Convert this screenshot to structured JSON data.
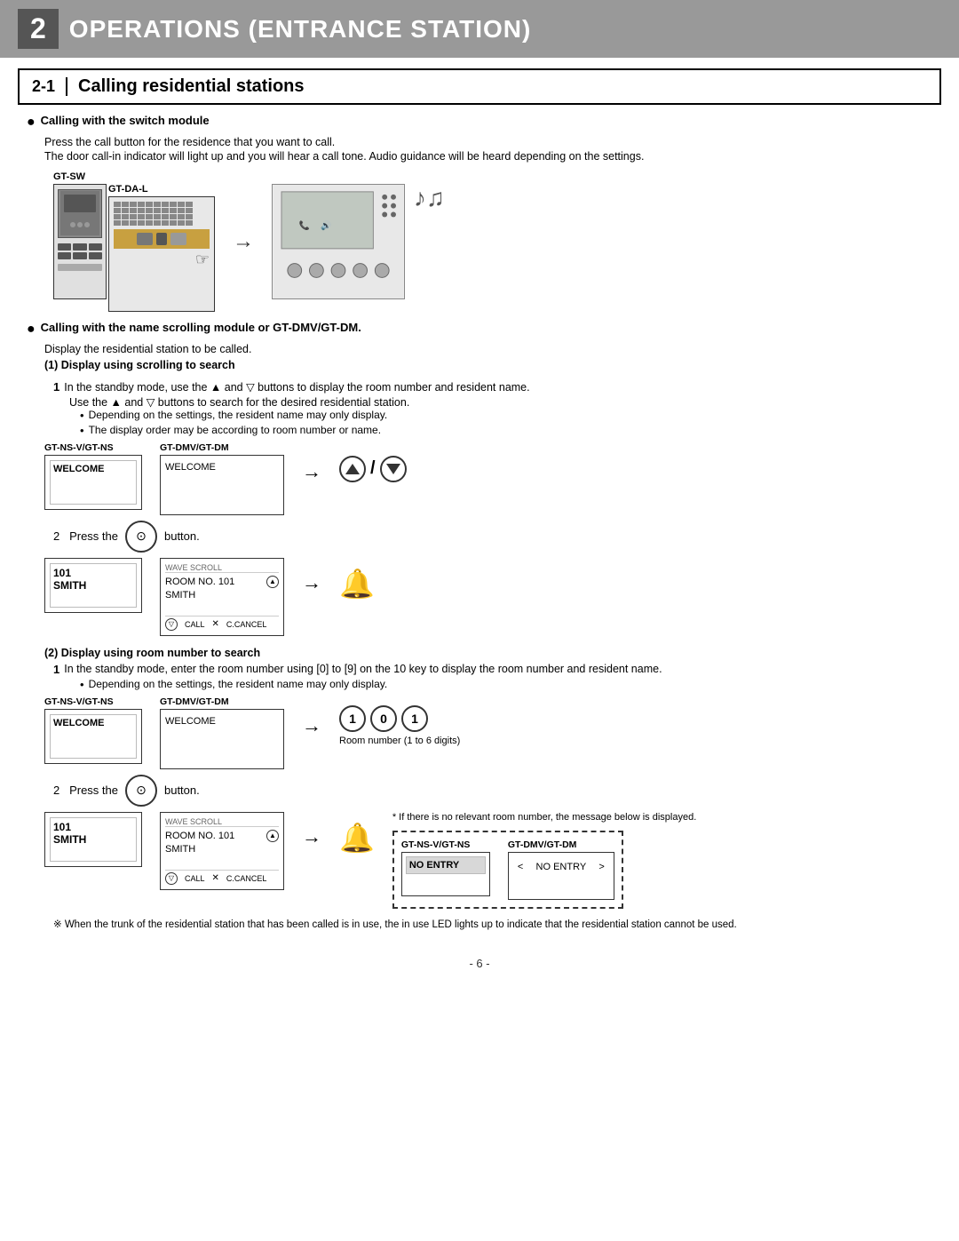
{
  "chapter": {
    "number": "2",
    "title": "OPERATIONS (ENTRANCE STATION)"
  },
  "section": {
    "number": "2-1",
    "title": "Calling residential stations"
  },
  "bullet1": {
    "label": "Calling with the switch module",
    "line1": "Press the call button for the residence that you want to call.",
    "line2": "The door call-in indicator will light up and you will hear a call tone. Audio guidance will be heard depending on the settings."
  },
  "devices": {
    "gt_sw": "GT-SW",
    "gt_da_l": "GT-DA-L",
    "gt_ns_v": "GT-NS-V/GT-NS",
    "gt_dmv_dm": "GT-DMV/GT-DM"
  },
  "bullet2": {
    "label": "Calling with the name scrolling module or GT-DMV/GT-DM.",
    "line1": "Display the residential station to be called.",
    "step1_header": "(1) Display using scrolling to search",
    "step1_1": "In the standby mode, use the ▲ and ▽ buttons to display the room number and resident name.",
    "step1_1b": "Use the ▲ and ▽ buttons to search for the desired residential station.",
    "subbullet1": "Depending on the settings, the resident name may only display.",
    "subbullet2": "The display order may be according to room number or name.",
    "welcome": "WELCOME",
    "step2_label": "2   Press the",
    "step2_end": "button.",
    "room_101": "101",
    "smith": "SMITH",
    "room_no_101": "ROOM NO. 101",
    "smith2": "SMITH",
    "wave_scroll": "WAVE SCROLL",
    "call_label": "CALL",
    "cancel_label": "C.CANCEL"
  },
  "section2": {
    "header": "(2) Display using room number to search",
    "step1": "In the standby mode, enter the room number using [0] to [9] on the 10 key to display the room number and resident name.",
    "subbullet": "Depending on the settings, the resident name may only display.",
    "room_number_note": "Room number (1 to 6 digits)",
    "step2_label": "2   Press the",
    "step2_end": "button.",
    "no_entry_note": "* If there is no relevant room number, the message below is displayed.",
    "no_entry": "NO ENTRY",
    "footnote": "※ When the trunk of the residential station that has been called is in use, the in use LED lights up to indicate that the residential station cannot be used."
  },
  "page_number": "- 6 -"
}
